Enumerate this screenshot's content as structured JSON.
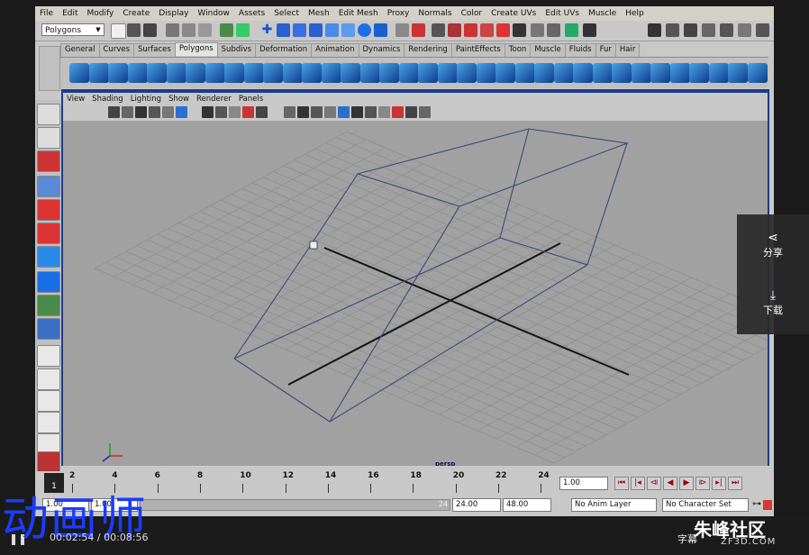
{
  "menu": [
    "File",
    "Edit",
    "Modify",
    "Create",
    "Display",
    "Window",
    "Assets",
    "Select",
    "Mesh",
    "Edit Mesh",
    "Proxy",
    "Normals",
    "Color",
    "Create UVs",
    "Edit UVs",
    "Muscle",
    "Help"
  ],
  "mode_selector": {
    "value": "Polygons"
  },
  "shelf_tabs": [
    "General",
    "Curves",
    "Surfaces",
    "Polygons",
    "Subdivs",
    "Deformation",
    "Animation",
    "Dynamics",
    "Rendering",
    "PaintEffects",
    "Toon",
    "Muscle",
    "Fluids",
    "Fur",
    "Hair"
  ],
  "active_shelf_tab": "Polygons",
  "panel_menu": [
    "View",
    "Shading",
    "Lighting",
    "Show",
    "Renderer",
    "Panels"
  ],
  "viewport": {
    "camera_label": "persp"
  },
  "time_slider": {
    "ticks": [
      "2",
      "4",
      "6",
      "8",
      "10",
      "12",
      "14",
      "16",
      "18",
      "20",
      "22",
      "24"
    ],
    "current_frame": "1",
    "current_time_field": "1.00"
  },
  "range_bar": {
    "start_time": "1.00",
    "range_start": "1.00",
    "range_handle": "24",
    "range_end": "24.00",
    "end_time": "48.00",
    "anim_layer": "No Anim Layer",
    "character_set": "No Character Set"
  },
  "side_panel": {
    "share_label": "分享",
    "download_label": "下载"
  },
  "overlay": {
    "watermark_big": "动画师",
    "time_current": "00:02:54",
    "time_total": "00:08:56",
    "subtitle_label": "字幕",
    "brand_name": "朱峰社区",
    "brand_url": "ZF3D.COM"
  },
  "colors": {
    "viewport_bg": "#a1a1a1",
    "grid": "#8c8c8c",
    "wire": "#3a4a7a",
    "frame_blue": "#1a3c8a",
    "accent_blue": "#1b3cff"
  }
}
